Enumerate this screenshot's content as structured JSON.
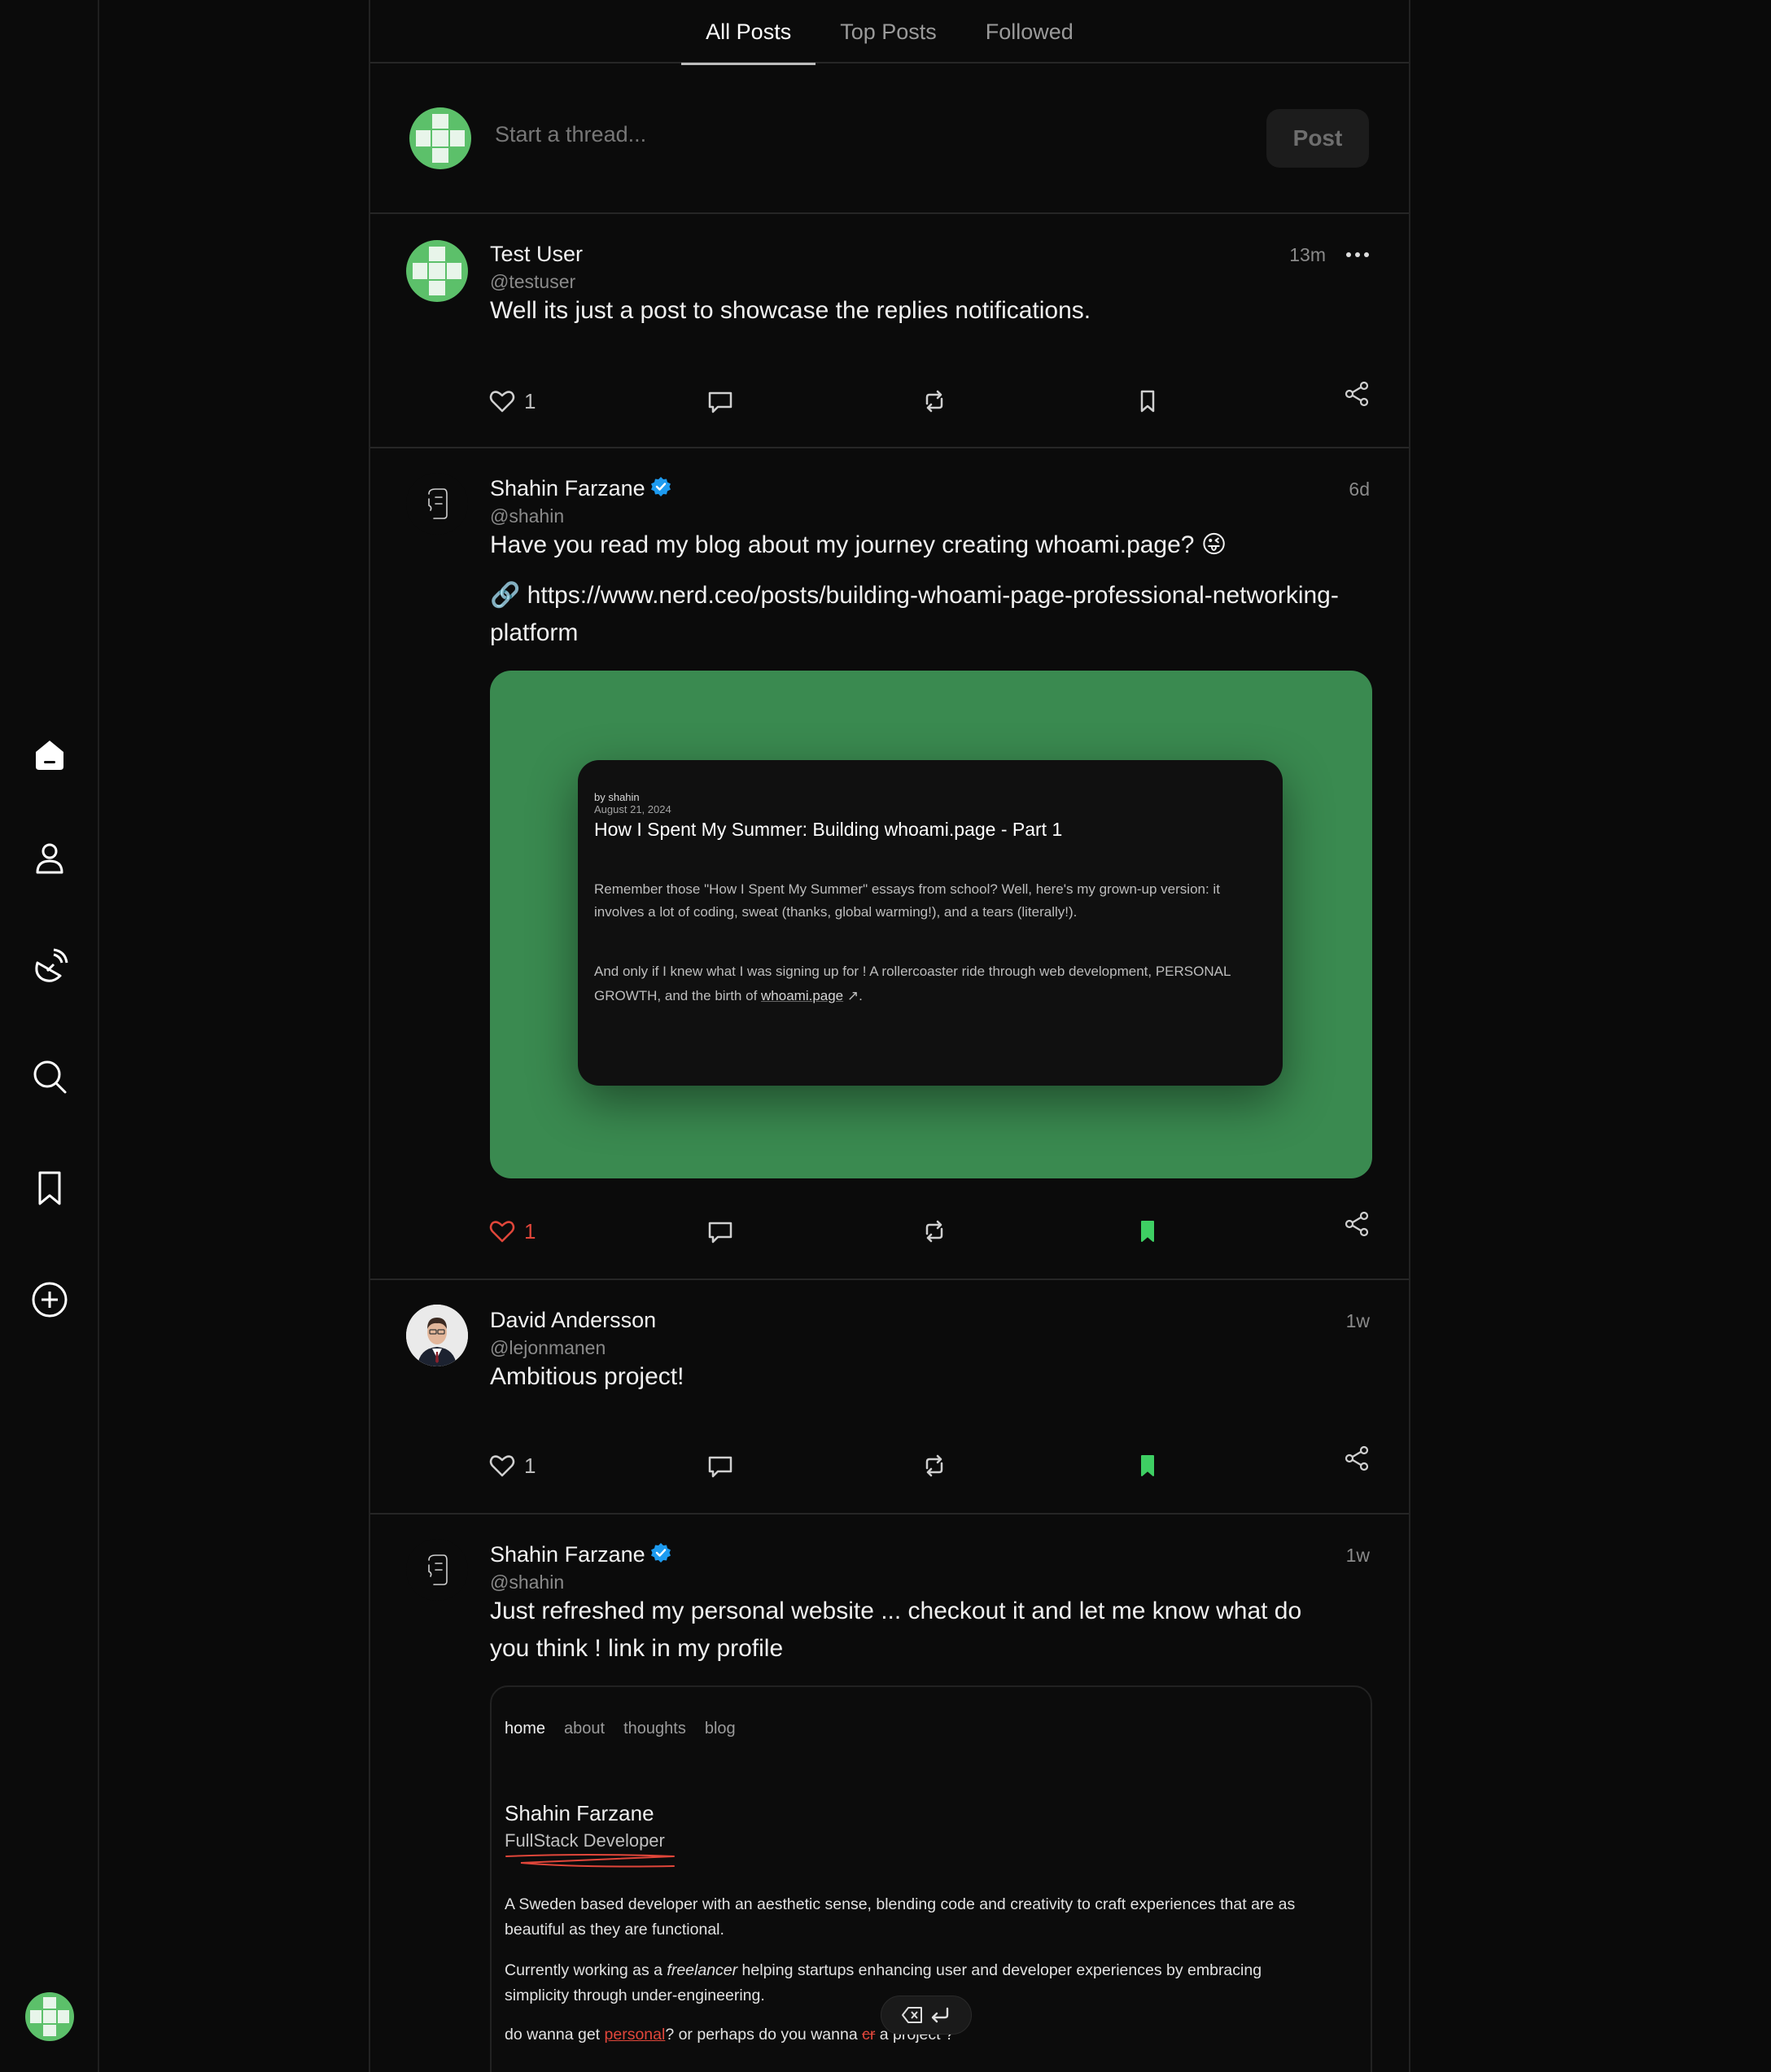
{
  "tabs": [
    "All Posts",
    "Top Posts",
    "Followed"
  ],
  "composer": {
    "placeholder": "Start a thread...",
    "post_label": "Post"
  },
  "posts": [
    {
      "name": "Test User",
      "handle": "@testuser",
      "time": "13m",
      "text": "Well its just a post to showcase the replies notifications.",
      "likes": "1",
      "liked": false,
      "bookmarked": false
    },
    {
      "name": "Shahin Farzane",
      "handle": "@shahin",
      "time": "6d",
      "text": "Have you read my blog about my journey creating whoami.page? 😜",
      "link": "🔗 https://www.nerd.ceo/posts/building-whoami-page-professional-networking-platform",
      "likes": "1",
      "liked": true,
      "bookmarked": true,
      "card": {
        "by": "by shahin",
        "date": "August 21, 2024",
        "title": "How I Spent My Summer: Building whoami.page - Part 1",
        "p1": "Remember those \"How I Spent My Summer\" essays from school? Well, here's my grown-up version: it involves a lot of coding, sweat (thanks, global warming!), and a tears (literally!).",
        "p2_pre": "And only if I knew what I was signing up for ! A rollercoaster ride through web development, PERSONAL GROWTH, and the birth of ",
        "p2_link": "whoami.page",
        "p2_post": " ↗."
      }
    },
    {
      "name": "David Andersson",
      "handle": "@lejonmanen",
      "time": "1w",
      "text": "Ambitious project!",
      "likes": "1",
      "liked": false,
      "bookmarked": true
    },
    {
      "name": "Shahin Farzane",
      "handle": "@shahin",
      "time": "1w",
      "text": "Just refreshed my personal website ... checkout it and let me know what do you think ! link in my profile",
      "site": {
        "nav": [
          "home",
          "about",
          "thoughts",
          "blog"
        ],
        "name": "Shahin Farzane",
        "role": "FullStack Developer",
        "p1": "A Sweden based developer with an aesthetic sense, blending code and creativity to craft experiences that are as beautiful as they are functional.",
        "p2_pre": "Currently working as a ",
        "p2_em": "freelancer",
        "p2_post": " helping startups enhancing user and developer experiences by embracing simplicity through under-engineering.",
        "p3_pre": "do wanna get ",
        "p3_red": "personal",
        "p3_mid": "? or perhaps do you wanna ",
        "p3_strike": "cr",
        "p3_post": " a project ?"
      }
    }
  ],
  "colors": {
    "accent_green": "#3a8a50",
    "like_red": "#e0463a",
    "bookmark_green": "#3ecf63",
    "verified_blue": "#1d9bf0"
  }
}
